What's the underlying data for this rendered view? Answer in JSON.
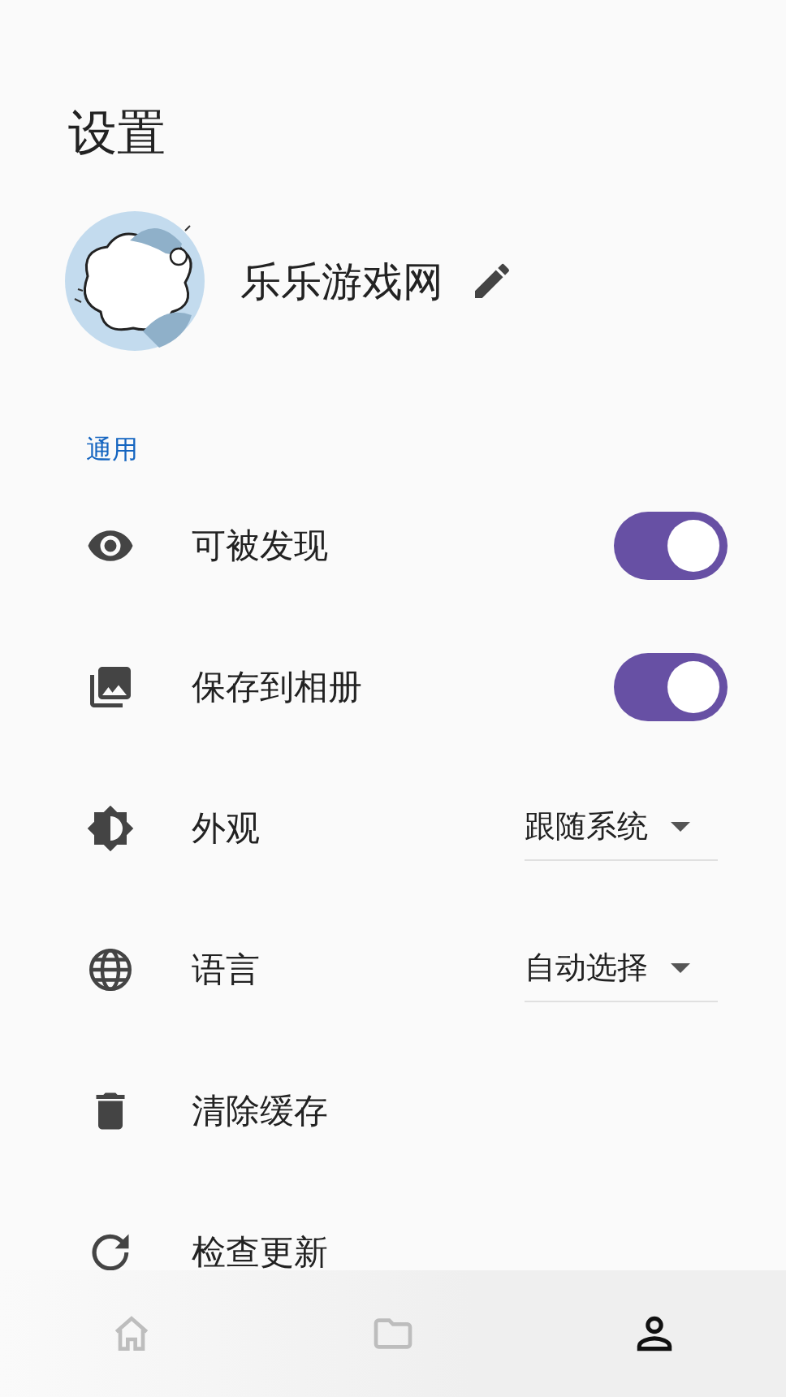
{
  "title": "设置",
  "profile": {
    "name": "乐乐游戏网"
  },
  "section": "通用",
  "settings": [
    {
      "label": "可被发现",
      "kind": "toggle",
      "on": true
    },
    {
      "label": "保存到相册",
      "kind": "toggle",
      "on": true
    },
    {
      "label": "外观",
      "kind": "dropdown",
      "value": "跟随系统"
    },
    {
      "label": "语言",
      "kind": "dropdown",
      "value": "自动选择"
    },
    {
      "label": "清除缓存",
      "kind": "action"
    },
    {
      "label": "检查更新",
      "kind": "action"
    }
  ],
  "nav": [
    {
      "selected": false
    },
    {
      "selected": false
    },
    {
      "selected": true
    }
  ]
}
